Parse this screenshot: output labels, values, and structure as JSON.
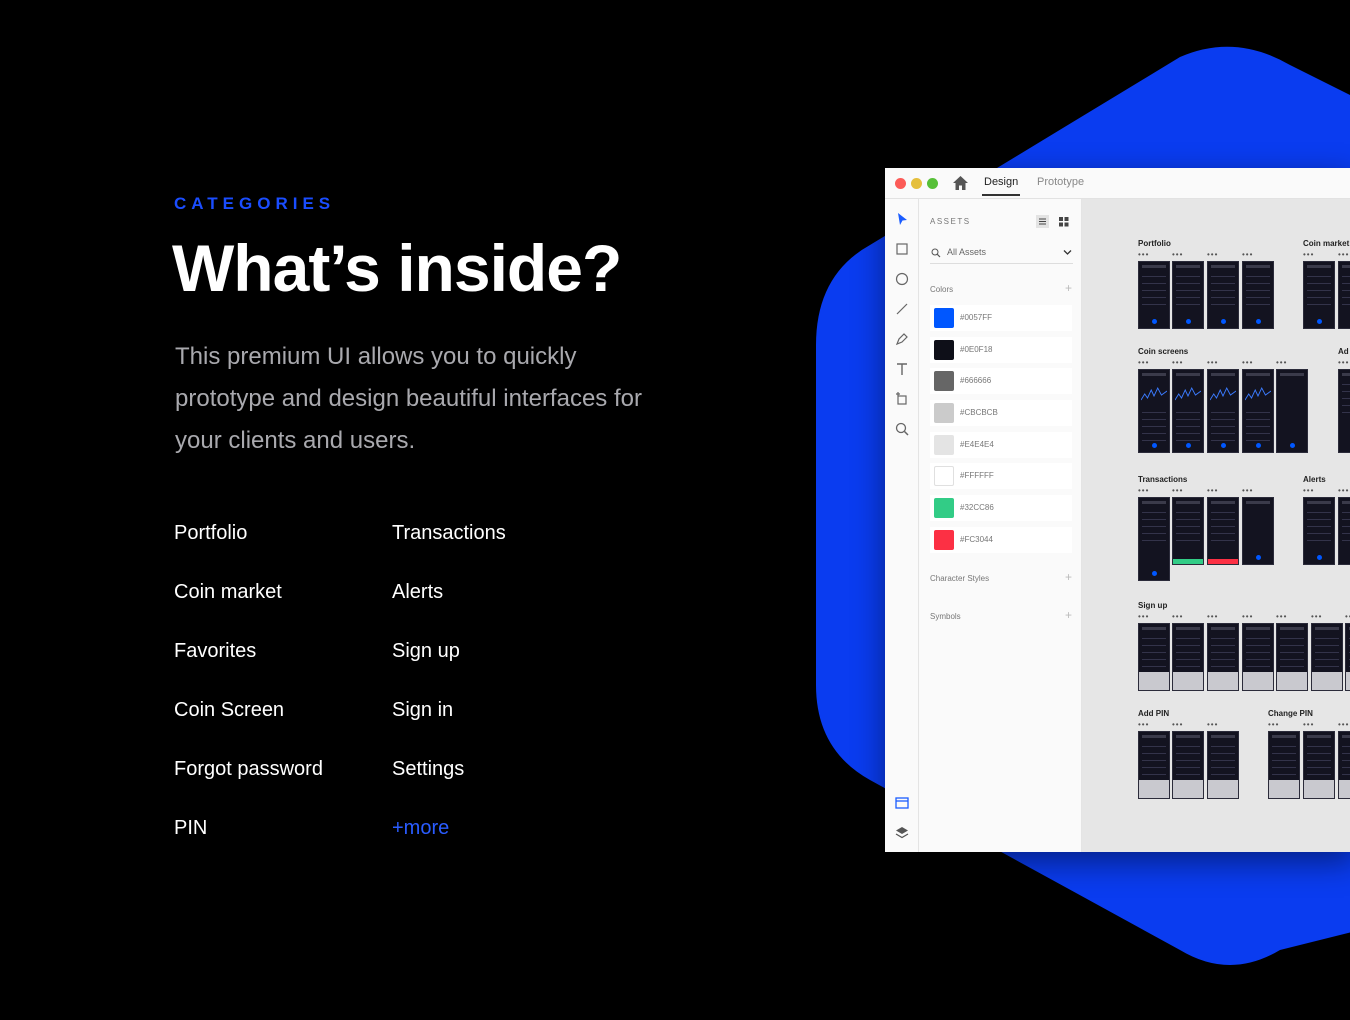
{
  "intro": {
    "eyebrow": "CATEGORIES",
    "headline": "What’s inside?",
    "description": "This premium UI allows you to quickly prototype and design beautiful interfaces for your clients and users."
  },
  "categories": [
    "Portfolio",
    "Transactions",
    "Coin market",
    "Alerts",
    "Favorites",
    "Sign up",
    "Coin Screen",
    "Sign in",
    "Forgot password",
    "Settings",
    "PIN",
    "+more"
  ],
  "brand_color": "#1a4dff",
  "window": {
    "tabs": {
      "design": "Design",
      "prototype": "Prototype"
    },
    "assets": {
      "title": "ASSETS",
      "search_label": "All Assets",
      "colors_label": "Colors",
      "colors": [
        {
          "hex": "#0057FF"
        },
        {
          "hex": "#0E0F18"
        },
        {
          "hex": "#666666"
        },
        {
          "hex": "#CBCBCB"
        },
        {
          "hex": "#E4E4E4"
        },
        {
          "hex": "#FFFFFF"
        },
        {
          "hex": "#32CC86"
        },
        {
          "hex": "#FC3044"
        }
      ],
      "character_styles_label": "Character Styles",
      "symbols_label": "Symbols"
    },
    "canvas_groups": {
      "portfolio": "Portfolio",
      "coin_market": "Coin market",
      "coin_screens": "Coin screens",
      "ad": "Ad",
      "transactions": "Transactions",
      "alerts": "Alerts",
      "sign_up": "Sign up",
      "add_pin": "Add PIN",
      "change_pin": "Change PIN"
    }
  }
}
